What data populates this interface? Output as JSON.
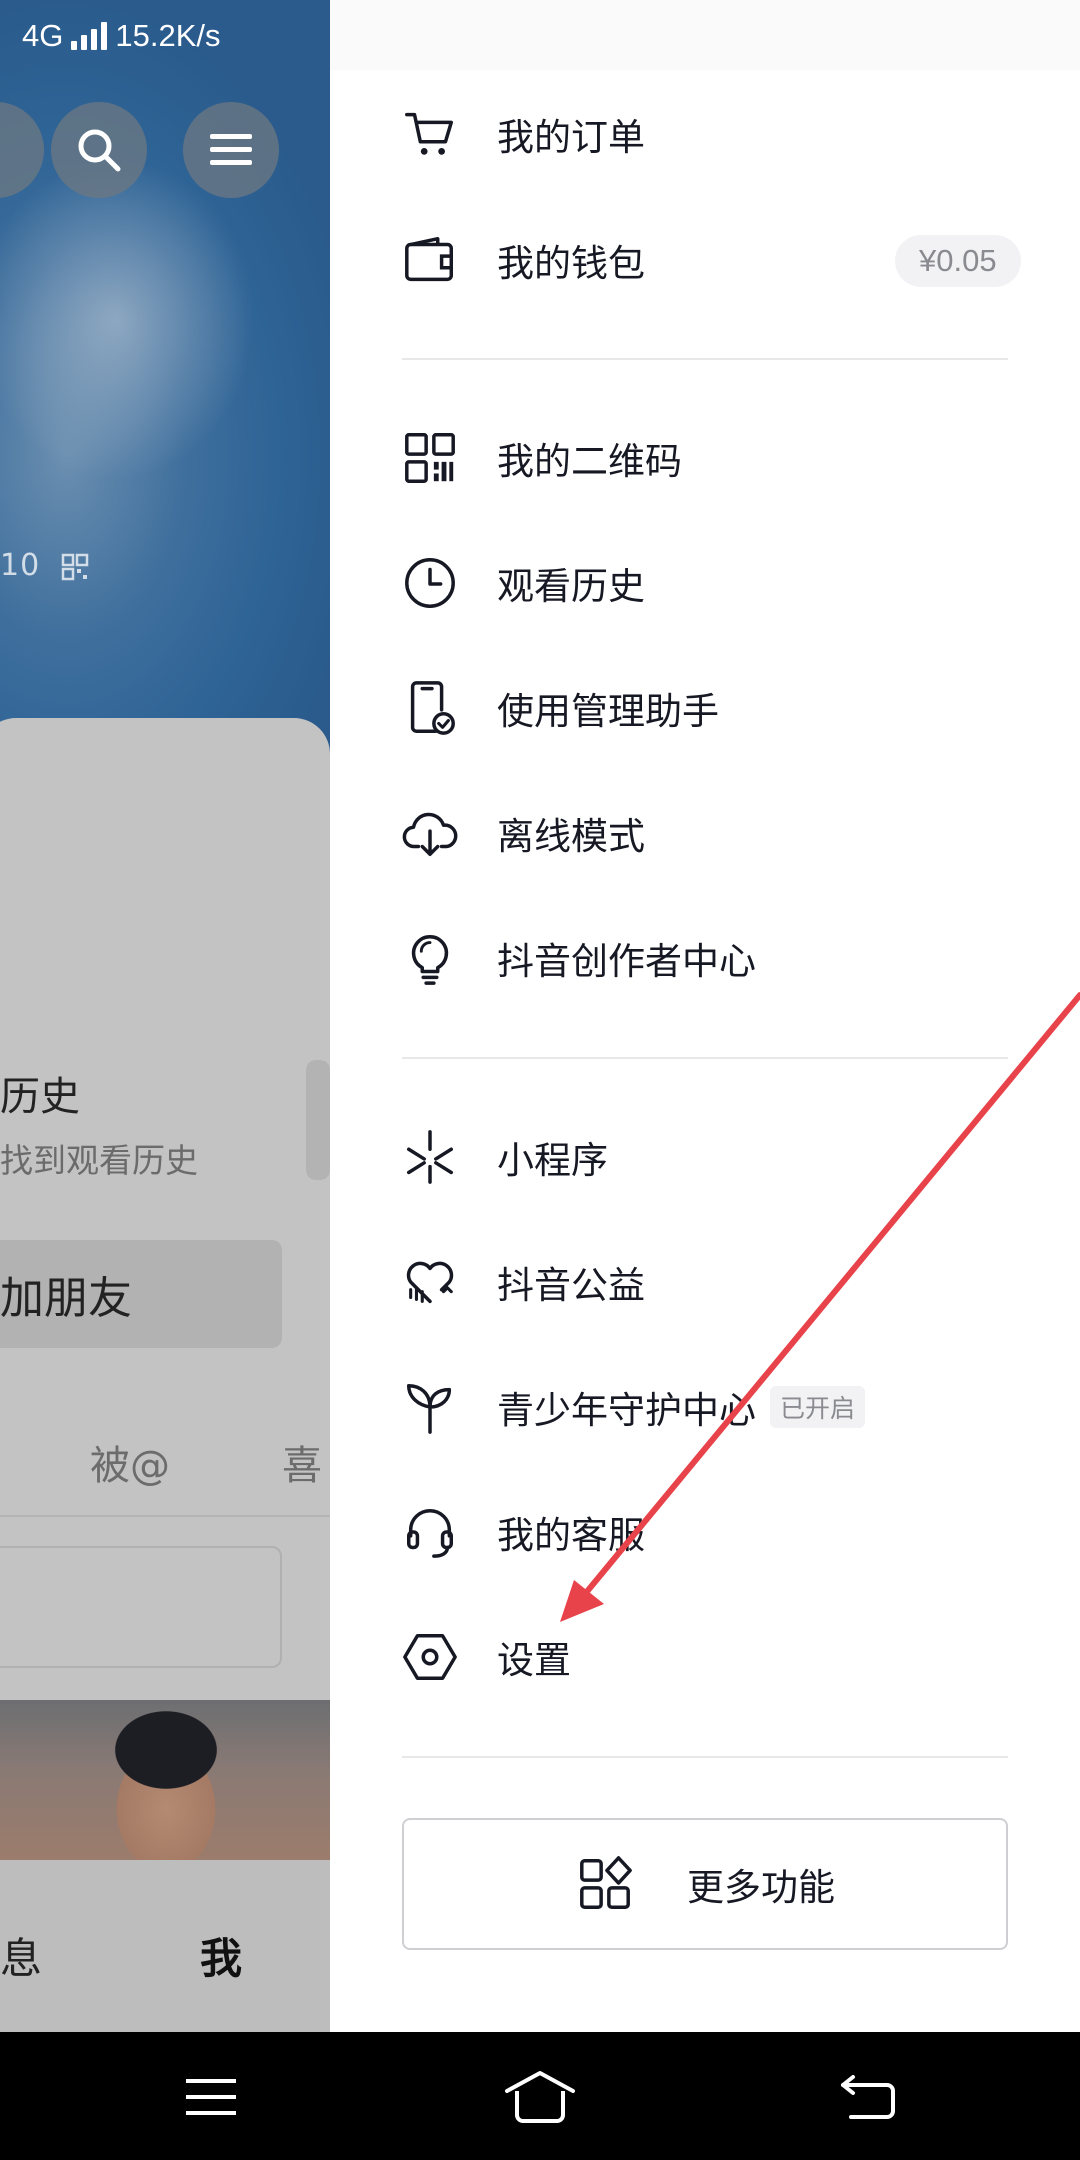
{
  "status_bar": {
    "network": "4G",
    "speed": "15.2K/s"
  },
  "background_profile": {
    "id_fragment": "10",
    "history_title": "历史",
    "history_subtitle": "找到观看历史",
    "add_friend_label": "加朋友",
    "tabs": {
      "mentions": "被@",
      "likes": "喜"
    },
    "bottom_nav": {
      "messages": "息",
      "me": "我"
    }
  },
  "drawer": {
    "items": [
      {
        "label": "我的订单",
        "icon": "cart-icon"
      },
      {
        "label": "我的钱包",
        "icon": "wallet-icon",
        "badge": "¥0.05"
      },
      {
        "label": "我的二维码",
        "icon": "qrcode-icon"
      },
      {
        "label": "观看历史",
        "icon": "clock-icon"
      },
      {
        "label": "使用管理助手",
        "icon": "phone-check-icon"
      },
      {
        "label": "离线模式",
        "icon": "cloud-download-icon"
      },
      {
        "label": "抖音创作者中心",
        "icon": "lightbulb-icon"
      },
      {
        "label": "小程序",
        "icon": "mini-program-icon"
      },
      {
        "label": "抖音公益",
        "icon": "heart-charity-icon"
      },
      {
        "label": "青少年守护中心",
        "icon": "sprout-icon",
        "badge": "已开启"
      },
      {
        "label": "我的客服",
        "icon": "headset-icon"
      },
      {
        "label": "设置",
        "icon": "hexagon-settings-icon"
      }
    ],
    "more_button": {
      "label": "更多功能",
      "icon": "apps-icon"
    }
  },
  "annotation": {
    "arrow_color": "#e8434a"
  },
  "system_nav": {
    "menu": "menu-icon",
    "home": "home-icon",
    "back": "back-icon"
  }
}
